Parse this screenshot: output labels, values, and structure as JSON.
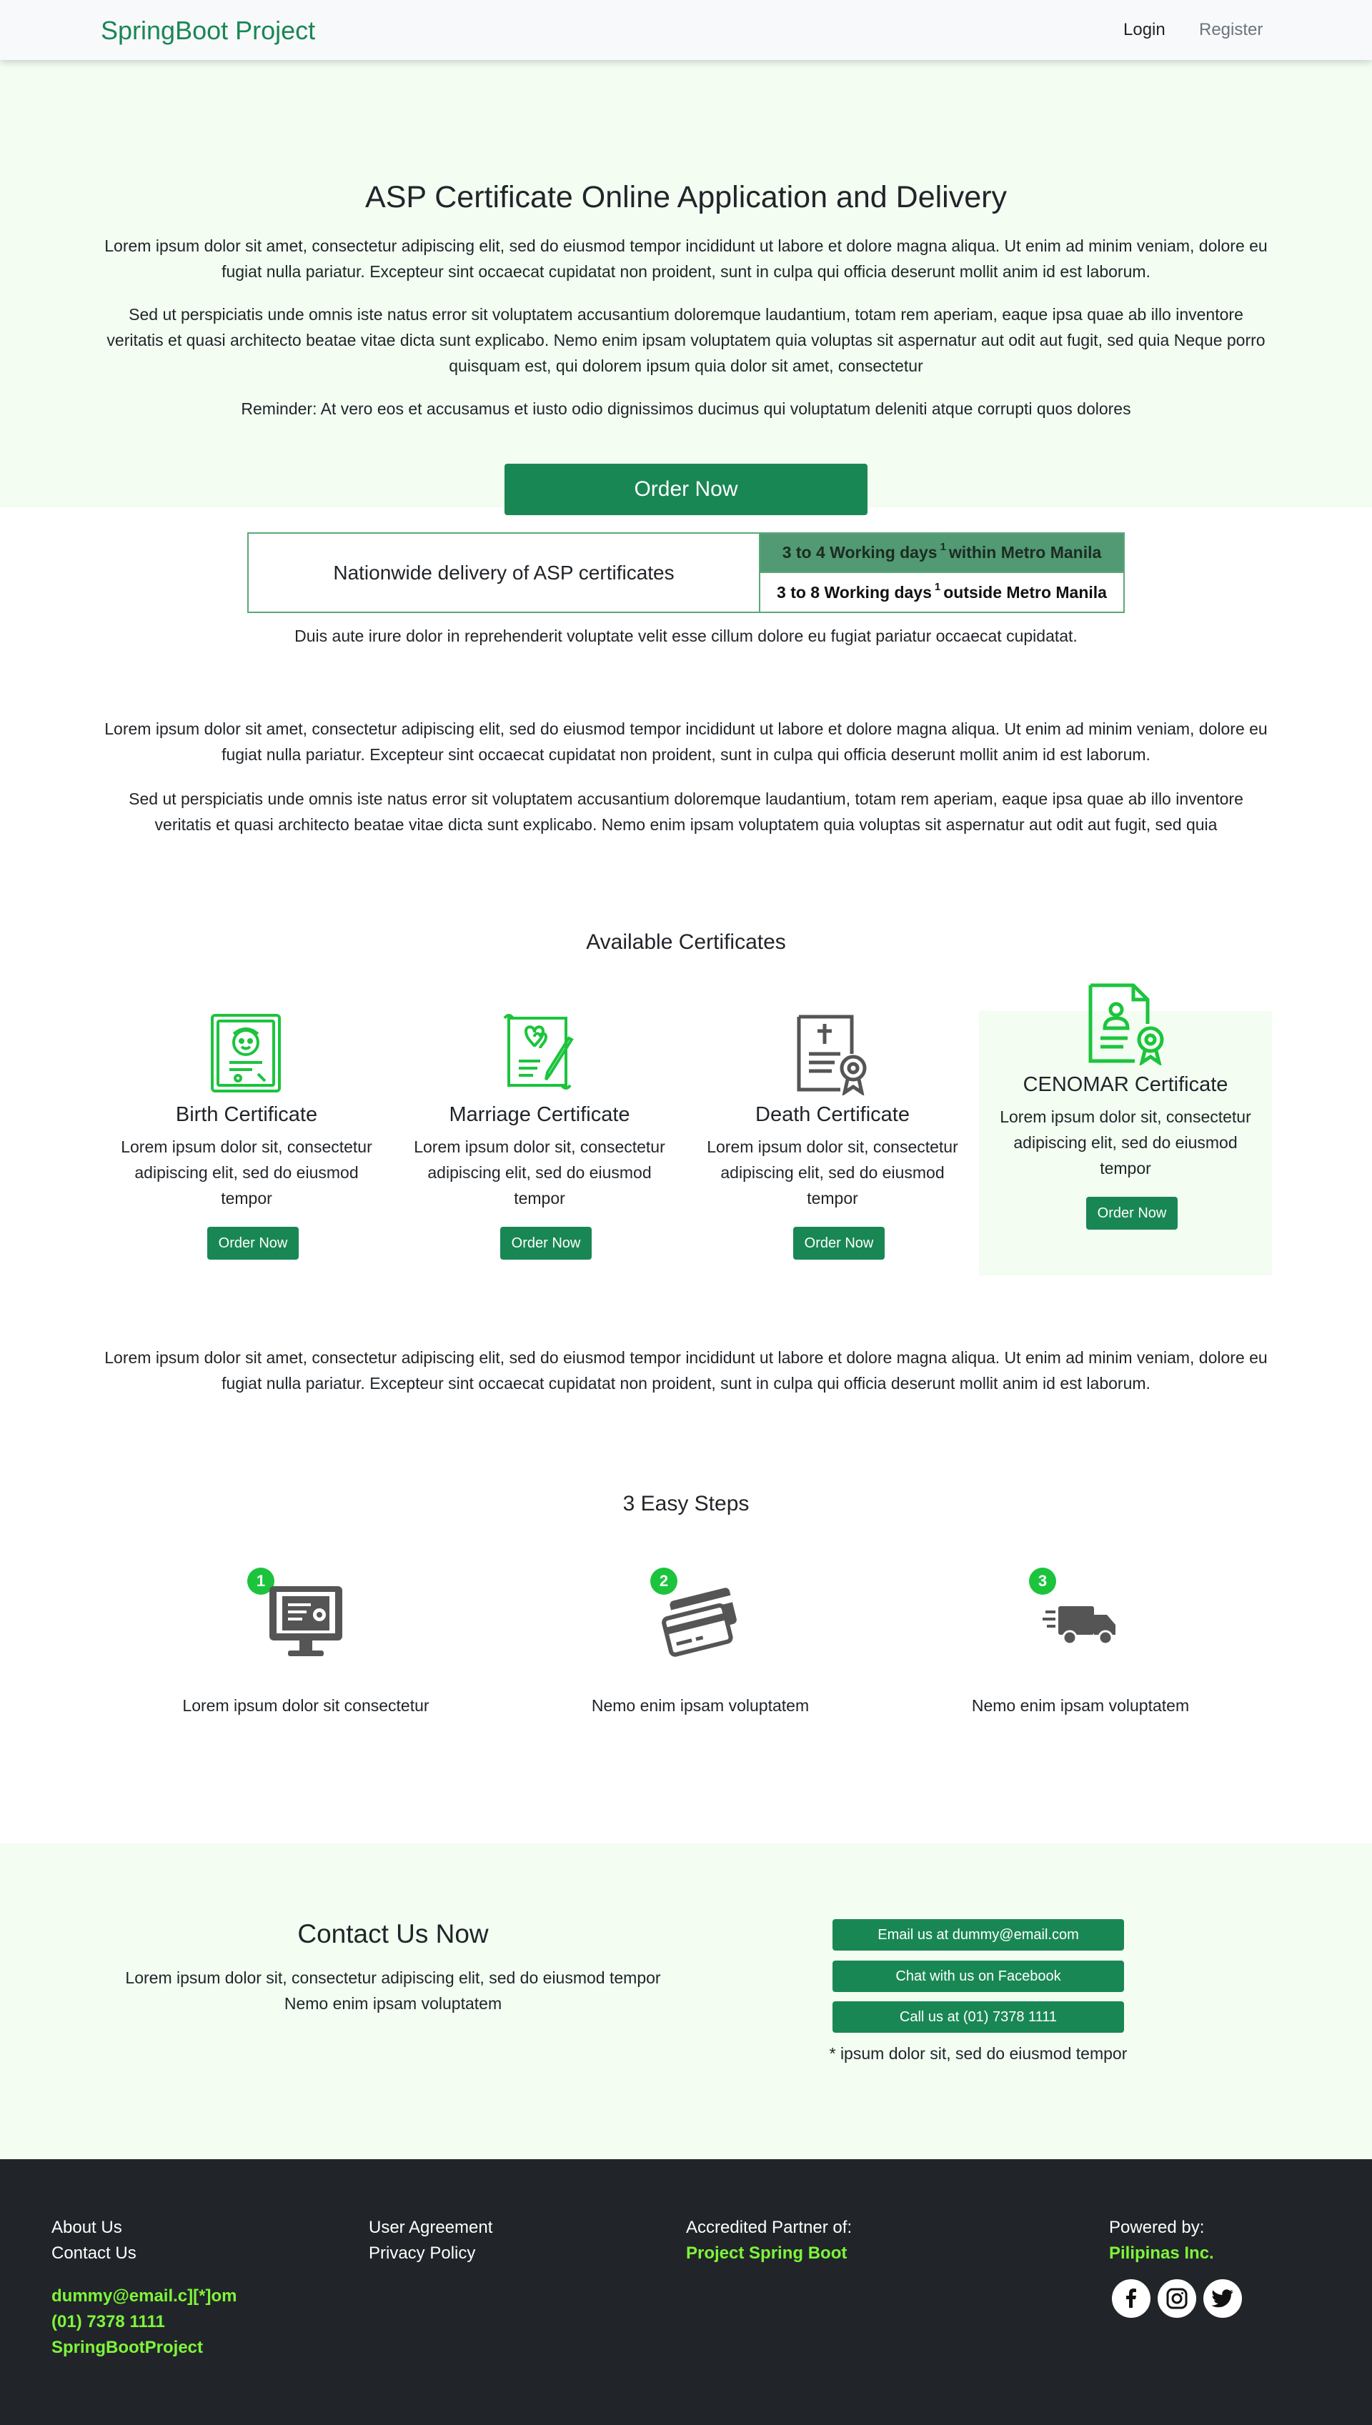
{
  "nav": {
    "brand": "SpringBoot Project",
    "login": "Login",
    "register": "Register"
  },
  "hero": {
    "title": "ASP Certificate Online Application and Delivery",
    "p1": "Lorem ipsum dolor sit amet, consectetur adipiscing elit, sed do eiusmod tempor incididunt ut labore et dolore magna aliqua. Ut enim ad minim veniam, dolore eu fugiat nulla pariatur. Excepteur sint occaecat cupidatat non proident, sunt in culpa qui officia deserunt mollit anim id est laborum.",
    "p2": "Sed ut perspiciatis unde omnis iste natus error sit voluptatem accusantium doloremque laudantium, totam rem aperiam, eaque ipsa quae ab illo inventore veritatis et quasi architecto beatae vitae dicta sunt explicabo. Nemo enim ipsam voluptatem quia voluptas sit aspernatur aut odit aut fugit, sed quia Neque porro quisquam est, qui dolorem ipsum quia dolor sit amet, consectetur",
    "reminder": "Reminder: At vero eos et accusamus et iusto odio dignissimos ducimus qui voluptatum deleniti atque corrupti quos dolores",
    "order_button": "Order Now"
  },
  "delivery": {
    "left": "Nationwide delivery of ASP certificates",
    "row1_a": "3 to 4 Working days",
    "row1_sup": "1",
    "row1_b": "within Metro Manila",
    "row2_a": "3 to 8 Working days",
    "row2_sup": "1",
    "row2_b": "outside Metro Manila",
    "note": "Duis aute irure dolor in reprehenderit voluptate velit esse cillum dolore eu fugiat pariatur occaecat cupidatat."
  },
  "middle": {
    "p1": "Lorem ipsum dolor sit amet, consectetur adipiscing elit, sed do eiusmod tempor incididunt ut labore et dolore magna aliqua. Ut enim ad minim veniam, dolore eu fugiat nulla pariatur. Excepteur sint occaecat cupidatat non proident, sunt in culpa qui officia deserunt mollit anim id est laborum.",
    "p2": "Sed ut perspiciatis unde omnis iste natus error sit voluptatem accusantium doloremque laudantium, totam rem aperiam, eaque ipsa quae ab illo inventore veritatis et quasi architecto beatae vitae dicta sunt explicabo. Nemo enim ipsam voluptatem quia voluptas sit aspernatur aut odit aut fugit, sed quia",
    "p3": "Lorem ipsum dolor sit amet, consectetur adipiscing elit, sed do eiusmod tempor incididunt ut labore et dolore magna aliqua. Ut enim ad minim veniam, dolore eu fugiat nulla pariatur. Excepteur sint occaecat cupidatat non proident, sunt in culpa qui officia deserunt mollit anim id est laborum."
  },
  "certificates": {
    "title": "Available Certificates",
    "items": [
      {
        "name": "Birth Certificate",
        "desc": "Lorem ipsum dolor sit, consectetur adipiscing elit, sed do eiusmod tempor",
        "button": "Order Now",
        "icon": "birth-certificate-icon"
      },
      {
        "name": "Marriage Certificate",
        "desc": "Lorem ipsum dolor sit, consectetur adipiscing elit, sed do eiusmod tempor",
        "button": "Order Now",
        "icon": "marriage-certificate-icon"
      },
      {
        "name": "Death Certificate",
        "desc": "Lorem ipsum dolor sit, consectetur adipiscing elit, sed do eiusmod tempor",
        "button": "Order Now",
        "icon": "death-certificate-icon"
      },
      {
        "name": "CENOMAR Certificate",
        "desc": "Lorem ipsum dolor sit, consectetur adipiscing elit, sed do eiusmod tempor",
        "button": "Order Now",
        "icon": "cenomar-certificate-icon"
      }
    ]
  },
  "steps": {
    "title": "3 Easy Steps",
    "items": [
      {
        "number": "1",
        "text": "Lorem ipsum dolor sit consectetur",
        "icon": "online-certificate-icon"
      },
      {
        "number": "2",
        "text": "Nemo enim ipsam voluptatem",
        "icon": "credit-card-icon"
      },
      {
        "number": "3",
        "text": "Nemo enim ipsam voluptatem",
        "icon": "delivery-truck-icon"
      }
    ]
  },
  "contact": {
    "title": "Contact Us Now",
    "desc": "Lorem ipsum dolor sit, consectetur adipiscing elit, sed do eiusmod tempor Nemo enim ipsam voluptatem",
    "email_button": "Email us at dummy@email.com",
    "facebook_button": "Chat with us on Facebook",
    "call_button": "Call us at (01) 7378 1111",
    "note": "* ipsum dolor sit, sed do eiusmod tempor"
  },
  "footer": {
    "about": "About Us",
    "contact": "Contact Us",
    "email": "dummy@email.c][*]om",
    "phone": "(01) 7378 1111",
    "handle": "SpringBootProject",
    "agreement": "User Agreement",
    "privacy": "Privacy Policy",
    "partner_label": "Accredited Partner of:",
    "partner": "Project Spring Boot",
    "powered_label": "Powered by:",
    "powered": "Pilipinas Inc.",
    "social": [
      "facebook-icon",
      "instagram-icon",
      "twitter-icon"
    ]
  },
  "colors": {
    "brand": "#198754",
    "hero_bg": "#f3fdf2",
    "icon_green": "#1cc43d",
    "footer_bg": "#212529",
    "footer_highlight": "#7ef53a"
  }
}
